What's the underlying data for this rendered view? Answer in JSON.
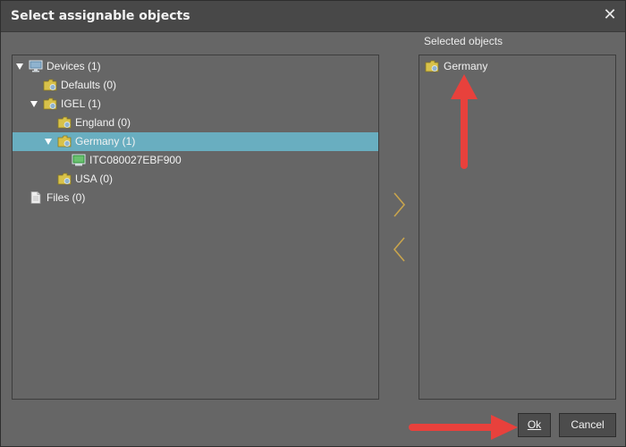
{
  "dialog": {
    "title": "Select assignable objects",
    "close_icon": "close-icon"
  },
  "tree": {
    "nodes": [
      {
        "label": "Devices (1)",
        "icon": "monitor-icon",
        "expanded": true,
        "selected": false
      },
      {
        "label": "Defaults (0)",
        "icon": "folder-icon",
        "expanded": false,
        "selected": false
      },
      {
        "label": "IGEL (1)",
        "icon": "folder-icon",
        "expanded": true,
        "selected": false
      },
      {
        "label": "England (0)",
        "icon": "folder-icon",
        "expanded": false,
        "selected": false
      },
      {
        "label": "Germany (1)",
        "icon": "folder-icon",
        "expanded": true,
        "selected": true
      },
      {
        "label": "ITC080027EBF900",
        "icon": "thin-client-icon",
        "expanded": false,
        "selected": false
      },
      {
        "label": "USA (0)",
        "icon": "folder-icon",
        "expanded": false,
        "selected": false
      },
      {
        "label": "Files (0)",
        "icon": "file-icon",
        "expanded": false,
        "selected": false
      }
    ]
  },
  "selected": {
    "label": "Selected objects",
    "items": [
      {
        "label": "Germany",
        "icon": "folder-icon"
      }
    ]
  },
  "transfer": {
    "add_icon": "chevron-right-icon",
    "remove_icon": "chevron-left-icon"
  },
  "buttons": {
    "ok_label": "Ok",
    "cancel_label": "Cancel"
  },
  "colors": {
    "selection": "#69aec0",
    "annotation_arrow": "#e8413c",
    "chevron": "#c8a44d",
    "folder": "#d8c24a"
  }
}
